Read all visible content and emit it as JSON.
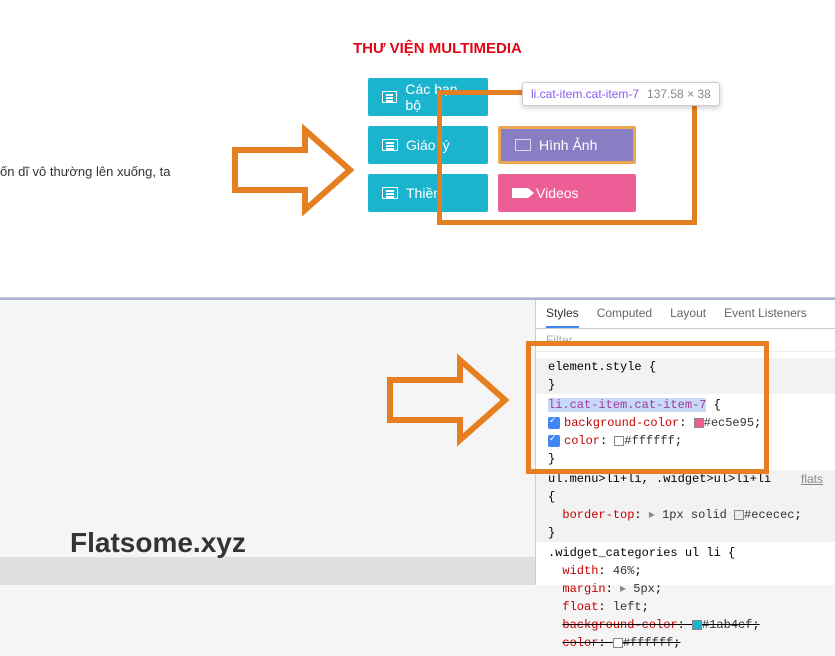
{
  "top": {
    "content_line": "ốn dĩ vô thường lên xuống, ta",
    "section_title": "THƯ VIỆN MULTIMEDIA",
    "buttons": {
      "r1c1": "Các bạn bộ",
      "r1c2_tooltip_selector": "li.cat-item.cat-item-7",
      "r1c2_tooltip_dims": "137.58 × 38",
      "r2c1": "Giáo lý",
      "r2c2": "Hình Ảnh",
      "r3c1": "Thiền",
      "r3c2": "Videos"
    }
  },
  "devtools": {
    "tabs": {
      "styles": "Styles",
      "computed": "Computed",
      "layout": "Layout",
      "listeners": "Event Listeners"
    },
    "filter_placeholder": "Filter",
    "rule1_sel": "element.style",
    "rule2_sel": "li.cat-item.cat-item-7",
    "rule2_bg_prop": "background-color",
    "rule2_bg_val": "#ec5e95",
    "rule2_color_prop": "color",
    "rule2_color_val": "#ffffff",
    "rule3_sel": "ul.menu>li+li, .widget>ul>li+li",
    "rule3_link": "flats",
    "rule3_prop": "border-top",
    "rule3_val": "1px solid",
    "rule3_color": "#ececec",
    "rule4_sel": ".widget_categories ul li",
    "rule4_width_prop": "width",
    "rule4_width_val": "46%",
    "rule4_margin_prop": "margin",
    "rule4_margin_val": "5px",
    "rule4_float_prop": "float",
    "rule4_float_val": "left",
    "rule4_bg_prop": "background-color",
    "rule4_bg_val": "#1ab4cf",
    "rule4_color_prop": "color",
    "rule4_color_val": "#ffffff"
  },
  "watermark": "Flatsome.xyz"
}
